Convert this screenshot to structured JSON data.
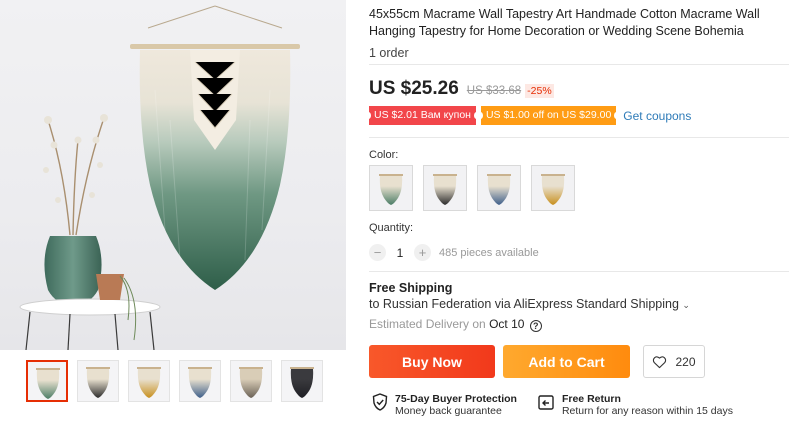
{
  "product": {
    "title": "45x55cm Macrame Wall Tapestry Art Handmade Cotton Macrame Wall Hanging Tapestry for Home Decoration or Wedding Scene Bohemia",
    "orders": "1 order"
  },
  "price": {
    "current": "US $25.26",
    "original": "US $33.68",
    "discount": "-25%"
  },
  "coupons": {
    "coupon1": "US $2.01 Вам купон",
    "coupon2": "US $1.00 off on US $29.00",
    "get_label": "Get coupons"
  },
  "color": {
    "label": "Color:",
    "options": [
      "green",
      "black",
      "blue",
      "yellow"
    ]
  },
  "quantity": {
    "label": "Quantity:",
    "value": "1",
    "minus": "−",
    "plus": "+",
    "available": "485 pieces available"
  },
  "shipping": {
    "title": "Free Shipping",
    "destination": "to Russian Federation via AliExpress Standard Shipping",
    "est_prefix": "Estimated Delivery on",
    "est_date": "Oct 10"
  },
  "actions": {
    "buy_now": "Buy Now",
    "add_to_cart": "Add to Cart",
    "wishlist_count": "220"
  },
  "guarantees": {
    "protection_title": "75-Day Buyer Protection",
    "protection_sub": "Money back guarantee",
    "return_title": "Free Return",
    "return_sub": "Return for any reason within 15 days"
  },
  "gallery": {
    "thumbnails": [
      "green",
      "black",
      "yellow",
      "blue",
      "cream",
      "dark"
    ]
  },
  "colors": {
    "accent": "#e62e04",
    "buy": "#f2391b",
    "cart": "#ff8b0e",
    "link": "#2e7bb8"
  }
}
